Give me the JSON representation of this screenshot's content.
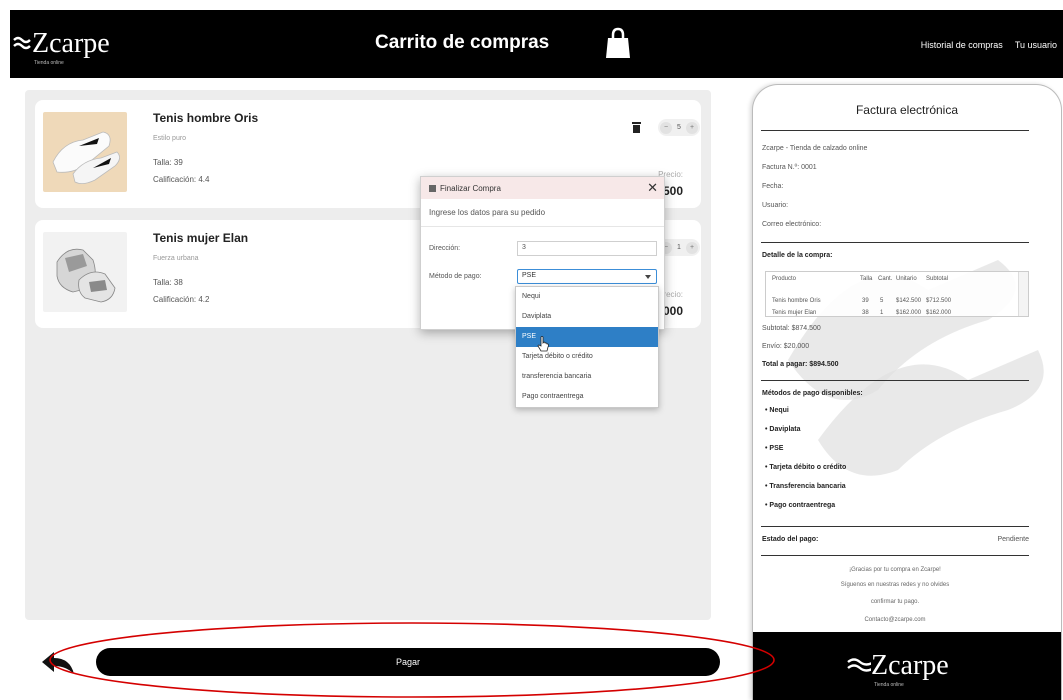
{
  "header": {
    "brand": "Zcarpe",
    "tagline": "Tienda online",
    "title": "Carrito de compras",
    "links": [
      "Historial de compras",
      "Tu usuario"
    ]
  },
  "cart": {
    "items": [
      {
        "name": "Tenis hombre Oris",
        "style": "Estilo puro",
        "size": "Talla:  39",
        "rating": "Calificación:  4.4",
        "quantity": "5",
        "price_label": "Precio:",
        "price": "$712.500"
      },
      {
        "name": "Tenis mujer Elan",
        "style": "Fuerza urbana",
        "size": "Talla:  38",
        "rating": "Calificación:  4.2",
        "quantity": "1",
        "price_label": "Precio:",
        "price": "$162.000"
      }
    ]
  },
  "dialog": {
    "title": "Finalizar Compra",
    "subtitle": "Ingrese los datos para su pedido",
    "address_label": "Dirección:",
    "address_value": "3",
    "payment_label": "Método de pago:",
    "payment_selected": "PSE",
    "options": [
      "Nequi",
      "Daviplata",
      "PSE",
      "Tarjeta débito o crédito",
      "transferencia bancaria",
      "Pago contraentrega"
    ],
    "selected_index": 2
  },
  "invoice": {
    "title": "Factura electrónica",
    "store": "Zcarpe - Tienda de calzado online",
    "invoice_number": "Factura N.º: 0001",
    "date": "Fecha:",
    "user": "Usuario:",
    "email": "Correo electrónico:",
    "detail_heading": "Detalle de la compra:",
    "table": {
      "headers": [
        "Producto",
        "Talla",
        "Cant.",
        "Unitario",
        "Subtotal"
      ],
      "rows": [
        [
          "Tenis hombre Oris",
          "39",
          "5",
          "$142.500",
          "$712.500"
        ],
        [
          "Tenis mujer Elan",
          "38",
          "1",
          "$162.000",
          "$162.000"
        ]
      ]
    },
    "subtotal": "Subtotal: $874.500",
    "shipping": "Envío: $20.000",
    "total": "Total a pagar: $894.500",
    "methods_heading": "Métodos de pago disponibles:",
    "methods": [
      "• Nequi",
      "• Daviplata",
      "• PSE",
      "• Tarjeta débito o crédito",
      "• Transferencia bancaria",
      "• Pago contraentrega"
    ],
    "status_label": "Estado del pago:",
    "status_value": "Pendiente",
    "thanks": [
      "¡Gracias por tu compra en Zcarpe!",
      "Síguenos en nuestras redes y no olvides",
      "confirmar tu pago.",
      "Contacto@zcarpe.com"
    ],
    "footer_brand": "Zcarpe",
    "footer_tagline": "Tienda online"
  },
  "footer": {
    "pay_label": "Pagar"
  },
  "colors": {
    "topbar": "#000000",
    "panel": "#ededed",
    "selection": "#2e7fc6",
    "annotation": "#d40000"
  }
}
